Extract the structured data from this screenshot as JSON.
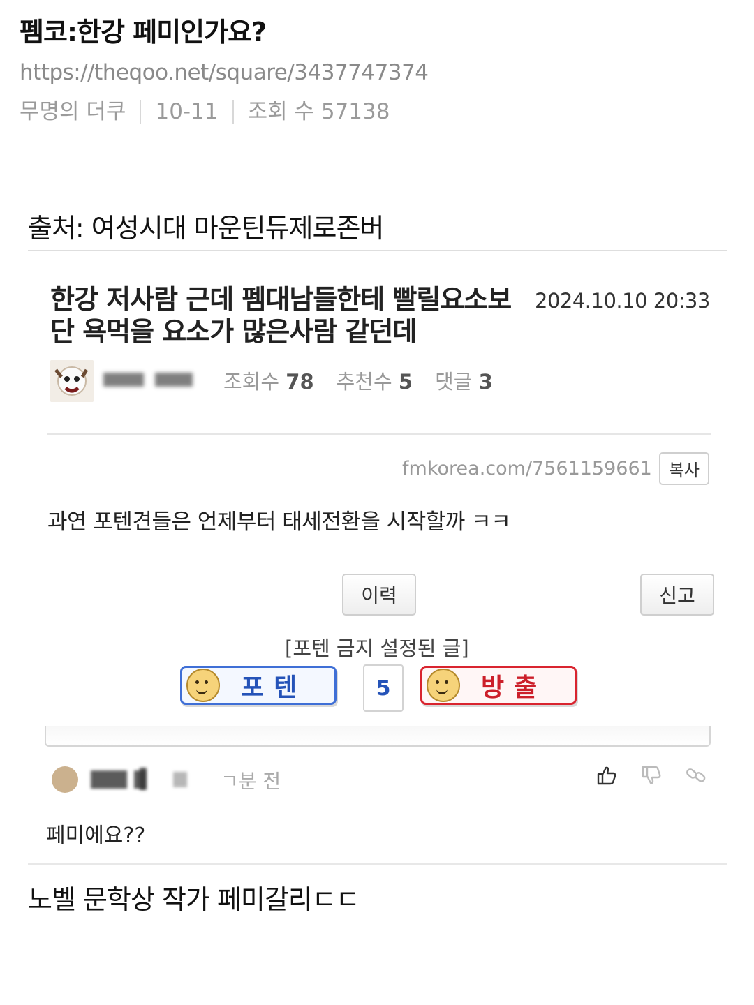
{
  "header": {
    "title": "펨코:한강 페미인가요?",
    "url": "https://theqoo.net/square/3437747374",
    "author": "무명의 더쿠",
    "date": "10-11",
    "views": "조회 수 57138"
  },
  "source": "출처: 여성시대 마운틴듀제로존버",
  "screenshot": {
    "title": "한강 저사람 근데 펨대남들한테 빨릴요소보단 욕먹을 요소가 많은사람 같던데",
    "date": "2024.10.10 20:33",
    "stats": {
      "views_label": "조회수",
      "views": "78",
      "recommend_label": "추천수",
      "recommend": "5",
      "comments_label": "댓글",
      "comments": "3"
    },
    "link": "fmkorea.com/7561159661",
    "copy_label": "복사",
    "body": "과연 포텐견들은 언제부터 태세전환을 시작할까 ㅋㅋ",
    "history_label": "이력",
    "report_label": "신고",
    "ban_label": "[포텐 금지 설정된 글]",
    "upvote_label": "포텐",
    "vote_count": "5",
    "downvote_label": "방출",
    "colors": {
      "upvote": "#3f6fd6",
      "downvote": "#d9242f"
    }
  },
  "comment": {
    "time": "ㄱ분 전",
    "text": "페미에요??",
    "icons": [
      "thumbs-up-icon",
      "thumbs-down-icon",
      "link-icon"
    ]
  },
  "closing_text": "노벨 문학상 작가 페미갈리ㄷㄷ"
}
